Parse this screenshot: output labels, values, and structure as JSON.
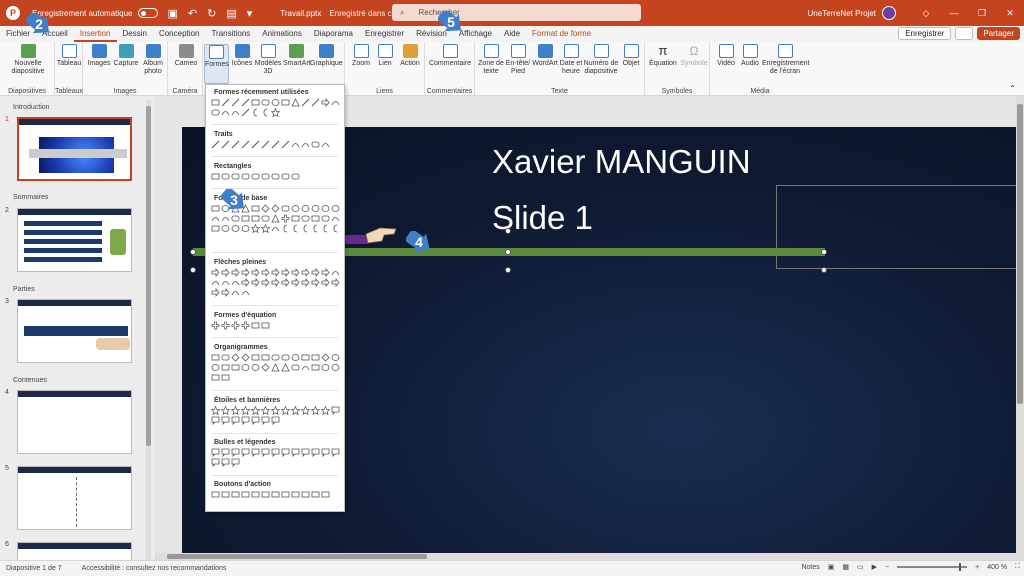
{
  "titlebar": {
    "autosave_label": "Enregistrement automatique",
    "file_name": "Travail.pptx",
    "saved_status": "Enregistré dans ce PC",
    "search_placeholder": "Rechercher",
    "user_name": "UneTerreNet Projet"
  },
  "tabs": {
    "items": [
      "Fichier",
      "Accueil",
      "Insertion",
      "Dessin",
      "Conception",
      "Transitions",
      "Animations",
      "Diaporama",
      "Enregistrer",
      "Révision",
      "Affichage",
      "Aide"
    ],
    "active": "Insertion",
    "contextual": "Format de forme",
    "save_button": "Enregistrer",
    "share_button": "Partager"
  },
  "ribbon": {
    "groups": {
      "diapositives": "Diapositives",
      "tableaux": "Tableaux",
      "images": "Images",
      "camera": "Caméra",
      "liens": "Liens",
      "commentaires": "Commentaires",
      "texte": "Texte",
      "symboles": "Symboles",
      "media": "Média"
    },
    "buttons": {
      "nouvelle_diapo": "Nouvelle diapositive",
      "tableau": "Tableau",
      "images": "Images",
      "capture": "Capture",
      "album": "Album photo",
      "cameo": "Cameo",
      "formes": "Formes",
      "icones": "Icônes",
      "modeles3d": "Modèles 3D",
      "smartart": "SmartArt",
      "graphique": "Graphique",
      "zoom": "Zoom",
      "lien": "Lien",
      "action": "Action",
      "commentaire": "Commentaire",
      "zone_texte": "Zone de texte",
      "entete": "En-tête/ Pied",
      "wordart": "WordArt",
      "date_heure": "Date et heure",
      "numero": "Numéro de diapositive",
      "objet": "Objet",
      "equation": "Équation",
      "symbole": "Symbole",
      "video": "Vidéo",
      "audio": "Audio",
      "enregistrement_ecran": "Enregistrement de l'écran"
    }
  },
  "shapes_menu": {
    "sections": [
      "Formes récemment utilisées",
      "Traits",
      "Rectangles",
      "Formes de base",
      "Flèches pleines",
      "Formes d'équation",
      "Organigrammes",
      "Étoiles et bannières",
      "Bulles et légendes",
      "Boutons d'action"
    ]
  },
  "slides_panel": {
    "sections": [
      "Introduction",
      "Sommaires",
      "Parties",
      "Contenues"
    ],
    "slide_numbers": [
      "1",
      "2",
      "3",
      "4",
      "5",
      "6"
    ]
  },
  "slide": {
    "title": "Xavier MANGUIN",
    "subtitle": "Slide 1"
  },
  "markers": [
    "2",
    "3",
    "4",
    "5"
  ],
  "statusbar": {
    "slide_info": "Diapositive 1 de 7",
    "accessibility": "Accessibilité : consultez nos recommandations",
    "notes": "Notes",
    "zoom": "400 %"
  },
  "colors": {
    "accent": "#c4441f",
    "slide_bg": "#0f1a33",
    "line": "#5a8a3a",
    "marker": "#3f7fc9"
  }
}
